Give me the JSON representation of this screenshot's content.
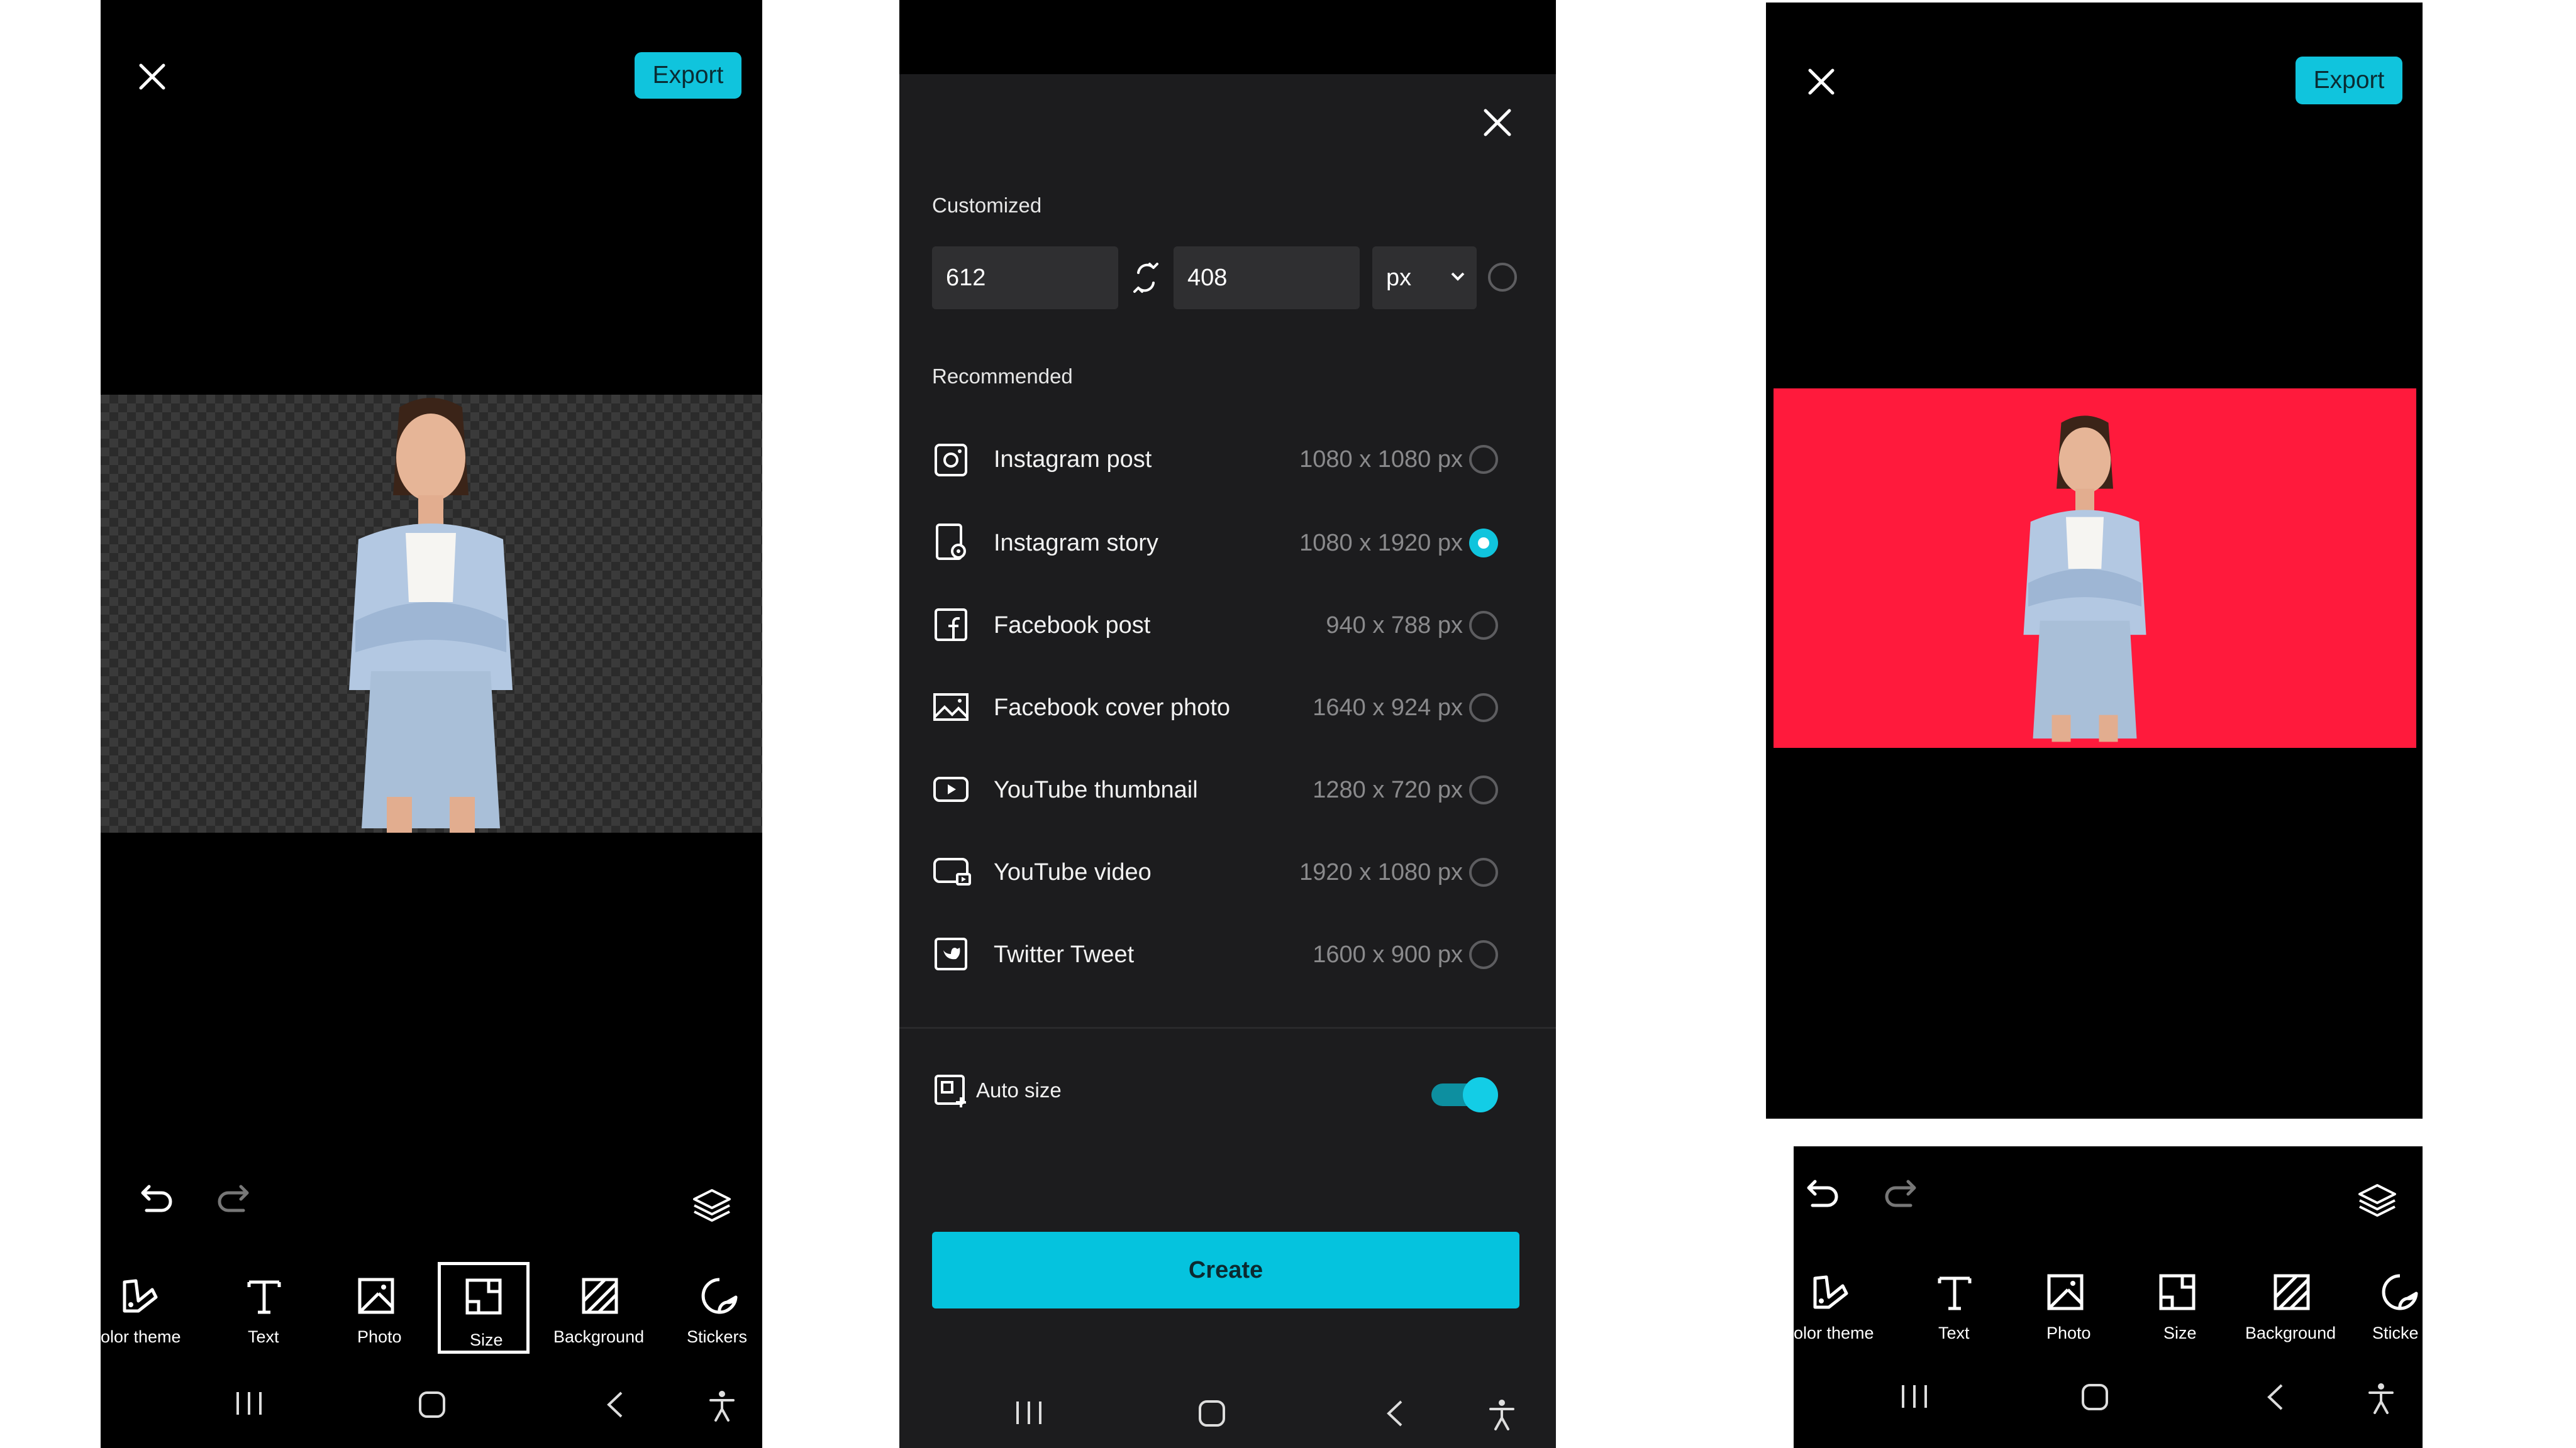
{
  "left_screen": {
    "export_label": "Export",
    "toolbar": [
      {
        "label": "olor theme",
        "icon": "palette-icon"
      },
      {
        "label": "Text",
        "icon": "text-icon"
      },
      {
        "label": "Photo",
        "icon": "photo-icon"
      },
      {
        "label": "Size",
        "icon": "size-icon",
        "selected": true
      },
      {
        "label": "Background",
        "icon": "background-icon"
      },
      {
        "label": "Stickers",
        "icon": "sticker-icon"
      }
    ]
  },
  "size_sheet": {
    "customized_label": "Customized",
    "width_value": "612",
    "height_value": "408",
    "unit": "px",
    "recommended_label": "Recommended",
    "options": [
      {
        "name": "Instagram post",
        "dims": "1080 x 1080 px",
        "icon": "instagram-icon",
        "selected": false
      },
      {
        "name": "Instagram story",
        "dims": "1080 x 1920 px",
        "icon": "story-icon",
        "selected": true
      },
      {
        "name": "Facebook post",
        "dims": "940 x 788 px",
        "icon": "facebook-icon",
        "selected": false
      },
      {
        "name": "Facebook cover photo",
        "dims": "1640 x 924 px",
        "icon": "image-icon",
        "selected": false
      },
      {
        "name": "YouTube thumbnail",
        "dims": "1280 x 720 px",
        "icon": "youtube-icon",
        "selected": false
      },
      {
        "name": "YouTube video",
        "dims": "1920 x 1080 px",
        "icon": "youtube-video-icon",
        "selected": false
      },
      {
        "name": "Twitter Tweet",
        "dims": "1600 x 900 px",
        "icon": "twitter-icon",
        "selected": false
      }
    ],
    "auto_size_label": "Auto size",
    "auto_size_on": true,
    "create_label": "Create"
  },
  "right_screen": {
    "export_label": "Export",
    "background_color": "#ff1a3c",
    "toolbar": [
      {
        "label": "olor theme",
        "icon": "palette-icon"
      },
      {
        "label": "Text",
        "icon": "text-icon"
      },
      {
        "label": "Photo",
        "icon": "photo-icon"
      },
      {
        "label": "Size",
        "icon": "size-icon"
      },
      {
        "label": "Background",
        "icon": "background-icon"
      },
      {
        "label": "Sticke",
        "icon": "sticker-icon"
      }
    ]
  },
  "colors": {
    "accent": "#10c4dd",
    "sheet_bg": "#1c1c1e",
    "selected_radio": "#10c4dd"
  }
}
